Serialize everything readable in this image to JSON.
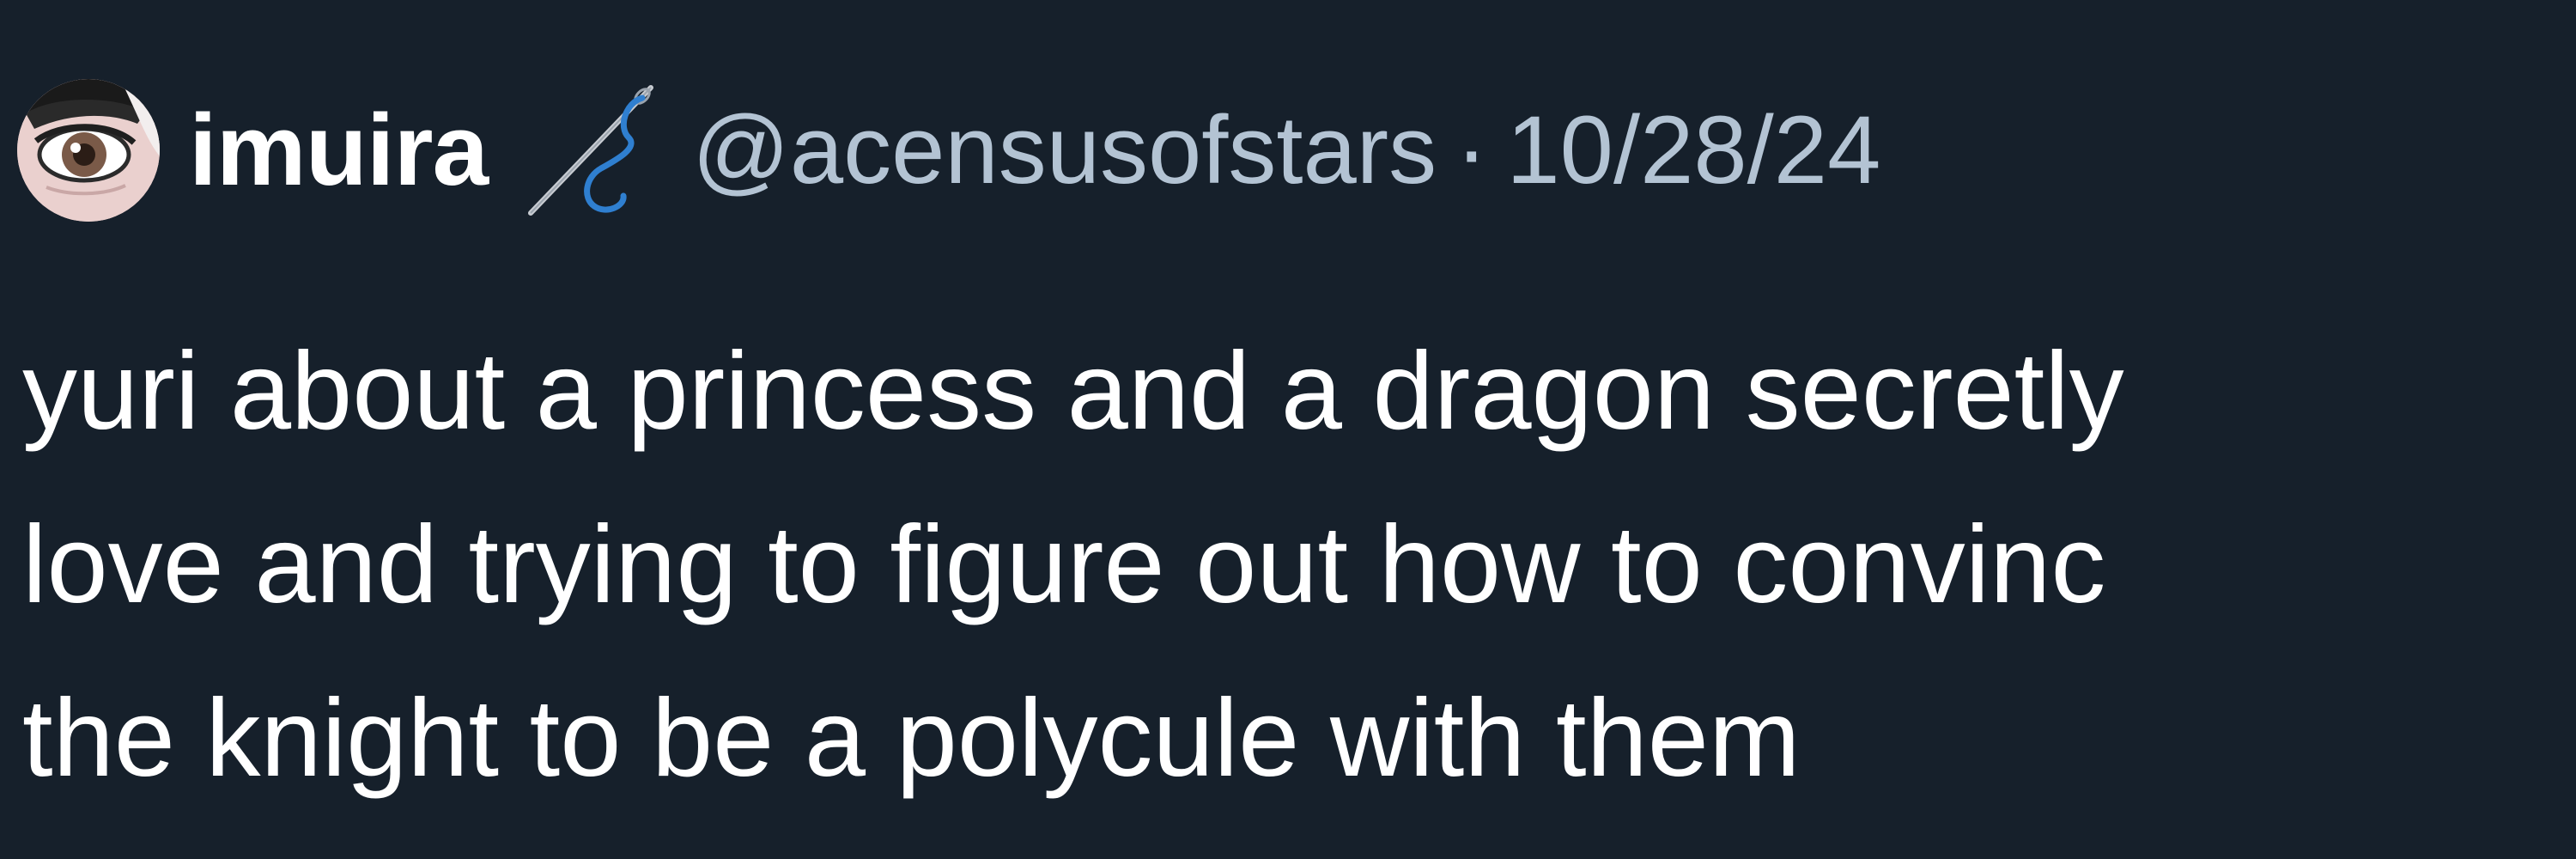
{
  "tweet": {
    "author": {
      "display_name": "imuira",
      "name_emoji_icon": "needle-and-thread-icon",
      "handle": "@acensusofstars"
    },
    "separator": "·",
    "timestamp": "10/28/24",
    "text_lines": [
      "yuri about a princess and a dragon secretly",
      "love and trying to figure out how to convinc",
      "the knight to be a polycule with them"
    ]
  },
  "colors": {
    "background": "#16202b",
    "primary_text": "#ffffff",
    "secondary_text": "#b3c3d3",
    "thread_blue": "#2f7fd0"
  }
}
